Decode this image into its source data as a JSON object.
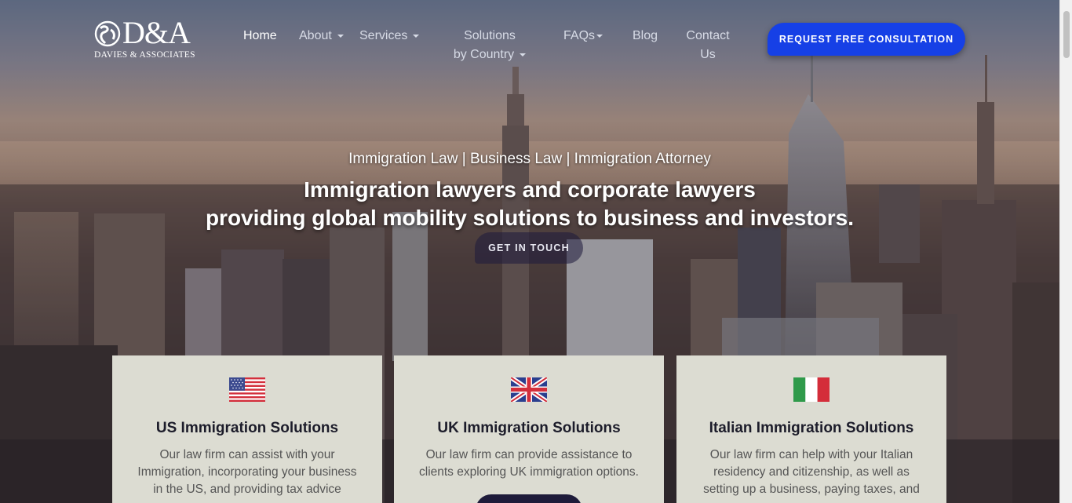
{
  "brand": {
    "logo_mark": "D&A",
    "logo_subtitle": "DAVIES & ASSOCIATES"
  },
  "nav": {
    "home": "Home",
    "about": "About",
    "services": "Services",
    "solutions_line1": "Solutions",
    "solutions_line2": "by Country",
    "faqs": "FAQs",
    "blog": "Blog",
    "contact_line1": "Contact",
    "contact_line2": "Us"
  },
  "cta": {
    "label": "REQUEST FREE CONSULTATION",
    "color": "#1640e6"
  },
  "hero": {
    "tagline": "Immigration Law | Business Law | Immigration Attorney",
    "headline_line1": "Immigration lawyers and corporate lawyers",
    "headline_line2": "providing global mobility solutions to business and investors.",
    "button": "GET IN TOUCH"
  },
  "cards": [
    {
      "flag": "us-flag-icon",
      "title": "US Immigration Solutions",
      "text_line1": "Our law firm can assist with your",
      "text_line2": "Immigration, incorporating your business",
      "text_line3": "in the US, and providing tax advice"
    },
    {
      "flag": "uk-flag-icon",
      "title": "UK Immigration Solutions",
      "text_line1": "Our law firm can provide assistance to",
      "text_line2": "clients exploring UK immigration options.",
      "text_line3": ""
    },
    {
      "flag": "italy-flag-icon",
      "title": "Italian Immigration Solutions",
      "text_line1": "Our law firm can help with your Italian",
      "text_line2": "residency and citizenship, as well as",
      "text_line3": "setting up a business, paying taxes, and"
    }
  ],
  "colors": {
    "card_bg": "#dcdcd2",
    "button_dark": "#1e1b3a",
    "title_text": "#1c1c2a"
  }
}
